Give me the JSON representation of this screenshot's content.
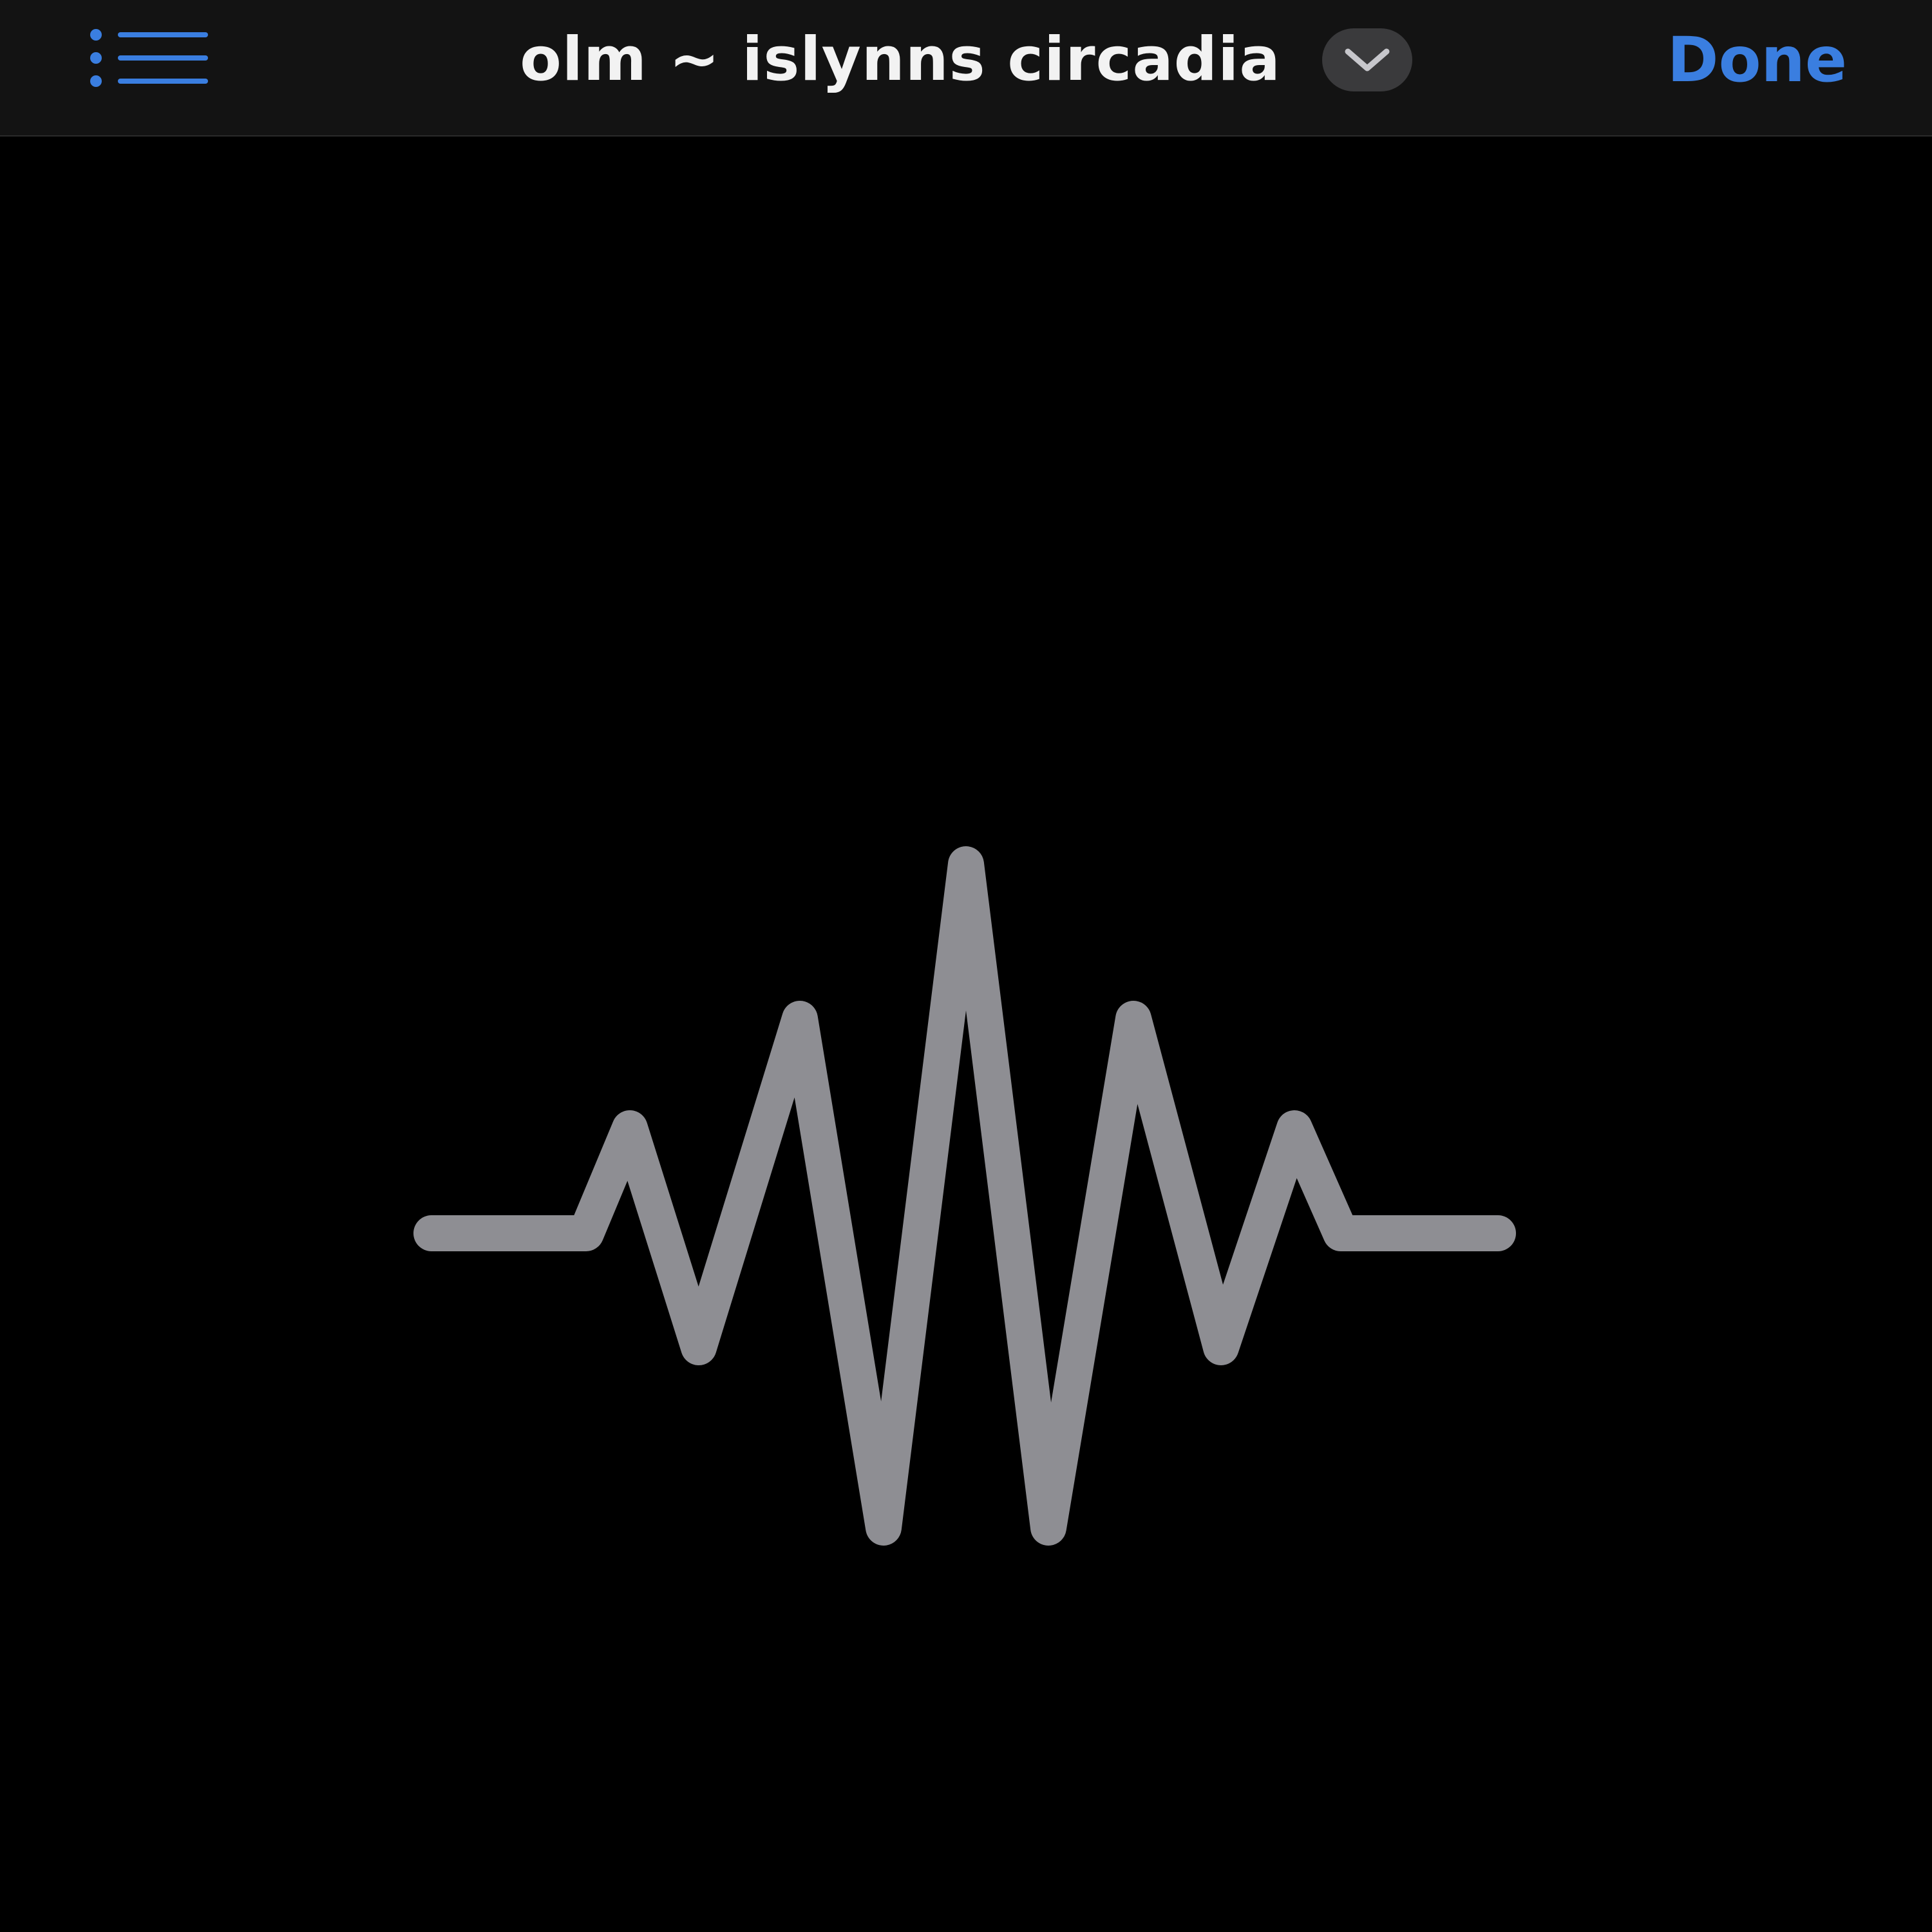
{
  "header": {
    "title": "olm ~ islynns circadia",
    "done_label": "Done",
    "list_icon": "list-icon",
    "chevron_icon": "chevron-down-icon"
  },
  "content": {
    "placeholder_icon": "waveform-icon"
  },
  "colors": {
    "accent": "#3a7ee0",
    "nav_background": "#131313",
    "page_background": "#000000",
    "title_text": "#f2f2f2",
    "waveform": "#8e8e93",
    "chevron_bg": "#3a3a3c"
  }
}
